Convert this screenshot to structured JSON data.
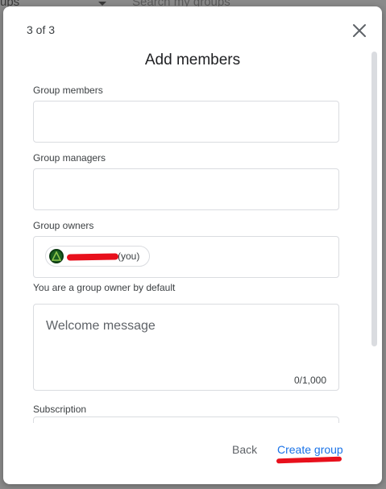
{
  "background": {
    "left_text": "ups",
    "search_placeholder": "Search my groups"
  },
  "dialog": {
    "step": "3 of 3",
    "title": "Add members",
    "fields": {
      "members_label": "Group members",
      "managers_label": "Group managers",
      "owners_label": "Group owners",
      "owner_chip_suffix": "(you)",
      "owner_helper": "You are a group owner by default",
      "welcome_placeholder": "Welcome message",
      "welcome_counter": "0/1,000",
      "subscription_label": "Subscription"
    },
    "actions": {
      "back": "Back",
      "create": "Create group"
    }
  },
  "colors": {
    "accent": "#1a73e8",
    "redaction": "#e8101c"
  }
}
